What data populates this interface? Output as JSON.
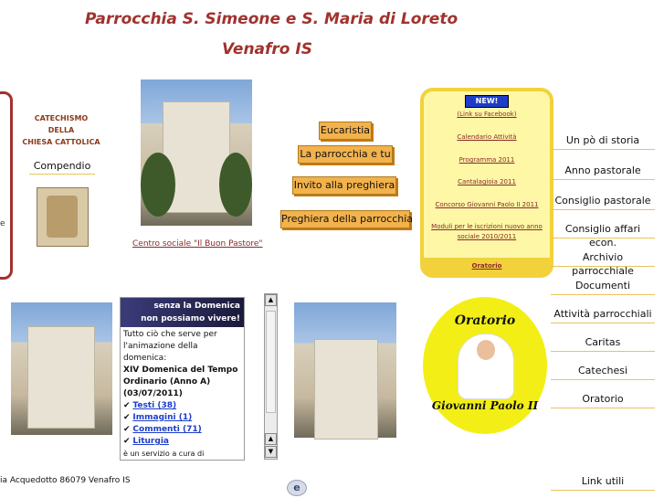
{
  "header": {
    "title_line1": "Parrocchia S. Simeone e S. Maria di Loreto",
    "title_line2": "Venafro IS"
  },
  "left_block": {
    "edge_letter": "e",
    "catechismo": [
      "CATECHISMO",
      "DELLA",
      "CHIESA CATTOLICA"
    ],
    "compendio": "Compendio"
  },
  "center_photo": {
    "caption": "Centro sociale \"Il Buon Pastore\""
  },
  "buttons": {
    "eucaristia": "Eucaristia",
    "parrocchia_e_tu": "La parrocchia e tu",
    "invito": "Invito alla preghiera",
    "preghiera": "Preghiera della parrocchia"
  },
  "news_box": {
    "badge": "NEW!",
    "facebook": "(Link su Facebook)",
    "items": [
      "Calendario Attività",
      "Programma 2011",
      "Cantalagioia 2011",
      "Concorso Giovanni Paolo II 2011",
      "Moduli per le iscrizioni nuovo anno sociale 2010/2011"
    ],
    "oratorio": "Oratorio"
  },
  "right_menu": [
    "Un pò di storia",
    "Anno pastorale",
    "Consiglio pastorale",
    "Consiglio affari econ.",
    "Archivio parrocchiale",
    "Documenti",
    "Attività parrocchiali",
    "Caritas",
    "Catechesi",
    "Oratorio"
  ],
  "link_utili": "Link utili",
  "schedule_box": {
    "header_line1": "senza la Domenica",
    "header_line2": "non possiamo vivere!",
    "intro": "Tutto ciò che serve per l'animazione della domenica:",
    "bold": "XIV Domenica del Tempo Ordinario (Anno A)",
    "date": "(03/07/2011)",
    "links": [
      "Testi (38)",
      "Immagini (1)",
      "Commenti (71)",
      "Liturgia"
    ],
    "tail": "è un servizio a cura di"
  },
  "oratorio_logo": {
    "top": "Oratorio",
    "bottom": "Giovanni Paolo II"
  },
  "footer": {
    "address": "ia Acquedotto  86079 Venafro IS"
  }
}
